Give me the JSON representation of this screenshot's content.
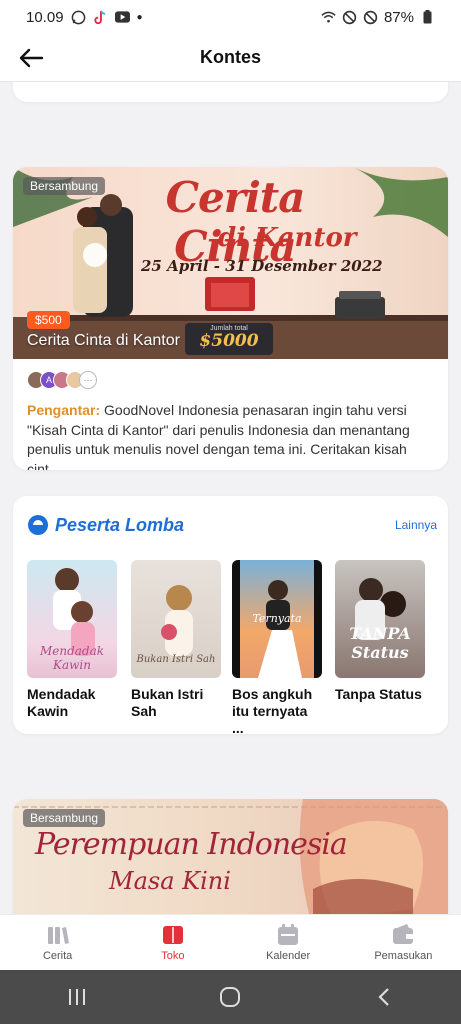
{
  "status_bar": {
    "time": "10.09",
    "battery": "87%"
  },
  "header": {
    "title": "Kontes"
  },
  "contest1": {
    "badge": "Bersambung",
    "banner_title_line1": "Cerita Cinta",
    "banner_title_line2": "di Kantor",
    "banner_date": "25 April - 31 Desember 2022",
    "banner_total_label": "Jumlah total",
    "banner_total_value": "$5000",
    "prize": "$500",
    "caption": "Cerita Cinta di Kantor",
    "avatar_letter": "A",
    "avatar_more": "···",
    "intro_label": "Pengantar:",
    "intro_text": "GoodNovel Indonesia penasaran ingin tahu versi \"Kisah Cinta di Kantor\" dari penulis Indonesia dan menantang penulis untuk menulis novel dengan tema ini. Ceritakan kisah cint..."
  },
  "peserta": {
    "title": "Peserta Lomba",
    "more_label": "Lainnya",
    "books": [
      {
        "title": "Mendadak Kawin",
        "cover_text": "Mendadak Kawin"
      },
      {
        "title": "Bukan Istri Sah",
        "cover_text": "Bukan Istri Sah"
      },
      {
        "title": "Bos angkuh itu ternyata ...",
        "cover_text": "Ternyata"
      },
      {
        "title": "Tanpa Status",
        "cover_text": "TANPA Status"
      }
    ]
  },
  "contest2": {
    "badge": "Bersambung",
    "banner_title_line1": "Perempuan Indonesia",
    "banner_title_line2": "Masa Kini"
  },
  "bottom_nav": {
    "items": [
      {
        "label": "Cerita",
        "icon": "library-icon"
      },
      {
        "label": "Toko",
        "icon": "store-book-icon",
        "active": true
      },
      {
        "label": "Kalender",
        "icon": "calendar-icon"
      },
      {
        "label": "Pemasukan",
        "icon": "wallet-icon"
      }
    ]
  },
  "colors": {
    "accent_red": "#e3303a",
    "link_blue": "#1d6fd8",
    "intro_orange": "#e0902a",
    "prize_orange": "#ff5a1f"
  }
}
